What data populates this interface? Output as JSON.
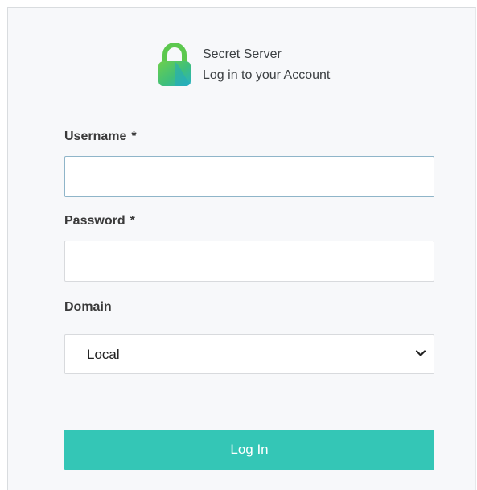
{
  "header": {
    "app_name": "Secret Server",
    "subtitle": "Log in to your Account"
  },
  "form": {
    "username": {
      "label": "Username",
      "required_marker": "*",
      "value": ""
    },
    "password": {
      "label": "Password",
      "required_marker": "*",
      "value": ""
    },
    "domain": {
      "label": "Domain",
      "selected": "Local"
    },
    "submit_label": "Log In"
  },
  "icons": {
    "logo": "padlock-logo-icon",
    "dropdown": "chevron-down-icon"
  },
  "colors": {
    "accent": "#34c6b6",
    "logo_green": "#4cc25a",
    "logo_teal": "#2bb3c0",
    "focus_border": "#8fb5c9"
  }
}
